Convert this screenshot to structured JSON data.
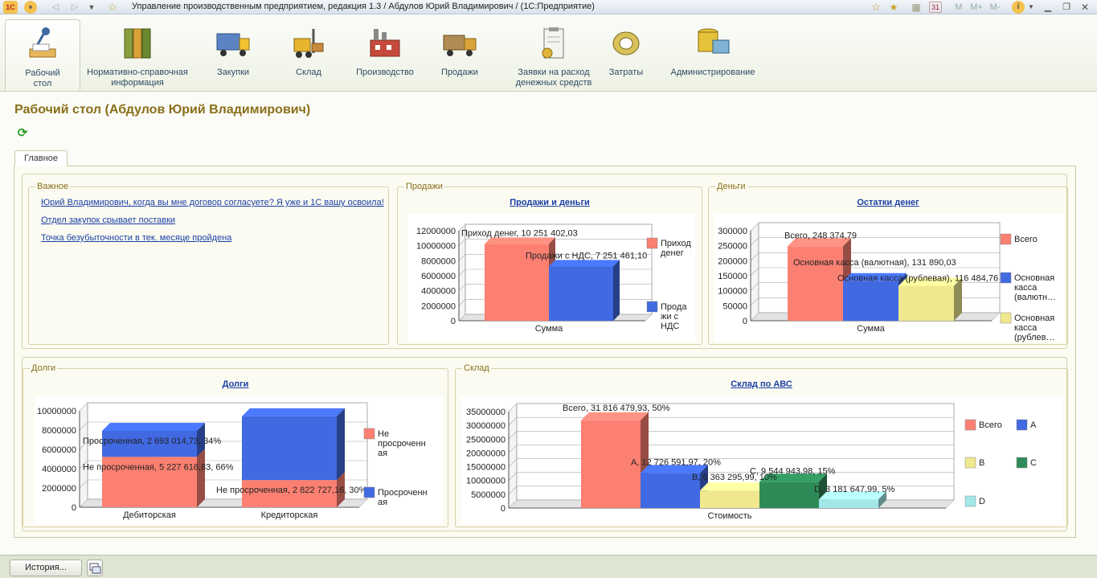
{
  "window": {
    "title": "Управление производственным предприятием, редакция 1.3 / Абдулов Юрий Владимирович /  (1С:Предприятие)",
    "right_buttons": [
      "M",
      "M+",
      "M-"
    ]
  },
  "sections": [
    {
      "label": "Рабочий\nстол",
      "icon": "desk-lamp-icon",
      "active": true
    },
    {
      "label": "Нормативно-справочная\nинформация",
      "icon": "binders-icon"
    },
    {
      "label": "Закупки",
      "icon": "truck-icon"
    },
    {
      "label": "Склад",
      "icon": "forklift-icon"
    },
    {
      "label": "Производство",
      "icon": "factory-icon"
    },
    {
      "label": "Продажи",
      "icon": "delivery-truck-icon"
    },
    {
      "label": "Заявки на расход\nденежных средств",
      "icon": "clipboard-icon"
    },
    {
      "label": "Затраты",
      "icon": "coins-icon"
    },
    {
      "label": "Администрирование",
      "icon": "database-computer-icon"
    }
  ],
  "page": {
    "title": "Рабочий стол (Абдулов Юрий Владимирович)",
    "tab": "Главное"
  },
  "important": {
    "title": "Важное",
    "links": [
      "Юрий Владимирович, когда вы мне договор согласуете? Я уже и 1С вашу освоила!",
      "Отдел закупок срывает поставки",
      "Точка безубыточности в тек. месяце пройдена"
    ]
  },
  "groups": {
    "sales": "Продажи",
    "money": "Деньги",
    "debts": "Долги",
    "stock": "Склад"
  },
  "colors": {
    "salmon": "#fb8072",
    "blue": "#4169e1",
    "yellow": "#efe88e",
    "green": "#2e8b57",
    "cyan": "#a3e8e8"
  },
  "chart_data": [
    {
      "id": "sales",
      "type": "bar",
      "title": "Продажи и деньги",
      "categories": [
        "Сумма"
      ],
      "ylim": [
        0,
        12000000
      ],
      "yticks": [
        "0",
        "2000000",
        "4000000",
        "6000000",
        "8000000",
        "10000000",
        "12000000"
      ],
      "series": [
        {
          "name": "Приход\nденег",
          "values": [
            10251402.03
          ],
          "label": "Приход денег, 10 251 402,03",
          "color": "#fb8072"
        },
        {
          "name": "Прода\nжи с\nНДС",
          "values": [
            7251461.1
          ],
          "label": "Продажи с НДС, 7 251 461,10",
          "color": "#4169e1"
        }
      ],
      "legend": "right"
    },
    {
      "id": "money",
      "type": "bar",
      "title": "Остатки денег",
      "categories": [
        "Сумма"
      ],
      "ylim": [
        0,
        300000
      ],
      "yticks": [
        "0",
        "50000",
        "100000",
        "150000",
        "200000",
        "250000",
        "300000"
      ],
      "series": [
        {
          "name": "Всего",
          "values": [
            248374.79
          ],
          "label": "Всего, 248 374,79",
          "color": "#fb8072"
        },
        {
          "name": "Основная\nкасса\n(валютн…",
          "values": [
            131890.03
          ],
          "label": "Основная касса (валютная), 131 890,03",
          "color": "#4169e1"
        },
        {
          "name": "Основная\nкасса\n(рублев…",
          "values": [
            116484.76
          ],
          "label": "Основная касса (рублевая), 116 484,76",
          "color": "#efe88e"
        }
      ],
      "legend": "right"
    },
    {
      "id": "debts",
      "type": "bar",
      "title": "Долги",
      "categories": [
        "Дебиторская",
        "Кредиторская"
      ],
      "ylim": [
        0,
        10000000
      ],
      "yticks": [
        "0",
        "2000000",
        "4000000",
        "6000000",
        "8000000",
        "10000000"
      ],
      "stacked": true,
      "series": [
        {
          "name": "Не\nпросроченн\nая",
          "values": [
            5227616.83,
            2822727.16
          ],
          "labels": [
            "Не просроченная, 5 227 616,83, 66%",
            "Не просроченная, 2 822 727,16, 30%"
          ],
          "color": "#fb8072"
        },
        {
          "name": "Просроченн\nая",
          "values": [
            2693014.73,
            6600000
          ],
          "labels": [
            "Просроченная, 2 693 014,73, 34%",
            ""
          ],
          "color": "#4169e1"
        }
      ],
      "legend": "right"
    },
    {
      "id": "stock",
      "type": "bar",
      "title": "Склад по АВС",
      "categories": [
        "Стоимость"
      ],
      "ylim": [
        0,
        35000000
      ],
      "yticks": [
        "0",
        "5000000",
        "10000000",
        "15000000",
        "20000000",
        "25000000",
        "30000000",
        "35000000"
      ],
      "series": [
        {
          "name": "Всего",
          "values": [
            31816479.93
          ],
          "label": "Всего, 31 816 479,93, 50%",
          "color": "#fb8072"
        },
        {
          "name": "A",
          "values": [
            12726591.97
          ],
          "label": "A, 12 726 591,97, 20%",
          "color": "#4169e1"
        },
        {
          "name": "B",
          "values": [
            6363295.99
          ],
          "label": "B, 6 363 295,99, 10%",
          "color": "#efe88e"
        },
        {
          "name": "C",
          "values": [
            9544943.98
          ],
          "label": "C, 9 544 943,98, 15%",
          "color": "#2e8b57"
        },
        {
          "name": "D",
          "values": [
            3181647.99
          ],
          "label": "D, 3 181 647,99, 5%",
          "color": "#a3e8e8"
        }
      ],
      "legend": "right"
    }
  ],
  "statusbar": {
    "history": "История..."
  }
}
